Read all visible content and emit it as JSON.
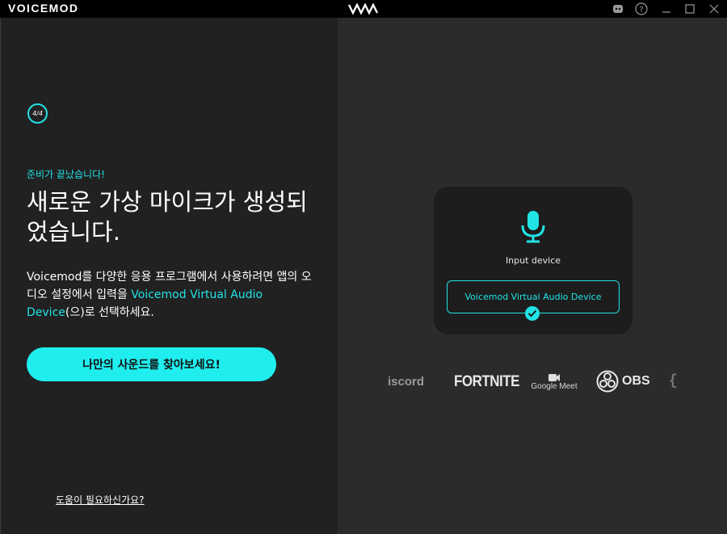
{
  "titlebar": {
    "brand": "VOICEMOD",
    "logo_icon": "vm-logo-icon",
    "buttons": [
      "discord-icon",
      "help-icon",
      "minimize-icon",
      "maximize-icon",
      "close-icon"
    ]
  },
  "onboarding": {
    "step": "4/4",
    "ready_text": "준비가 끝났습니다!",
    "headline": "새로운 가상 마이크가 생성되었습니다.",
    "description_part1": "Voicemod를 다양한 응용 프로그램에서 사용하려면 앱의 오디오 설정에서 입력을 ",
    "description_highlight": "Voicemod Virtual Audio Device",
    "description_part2": "(으)로 선택하세요.",
    "cta_label": "나만의 사운드를 찾아보세요!",
    "help_link": "도움이 필요하신가요?"
  },
  "device_card": {
    "label": "Input device",
    "device_name": "Voicemod Virtual Audio Device",
    "mic_icon": "microphone-icon",
    "check_icon": "check-icon"
  },
  "app_logos": [
    "iscord",
    "FORTNITE",
    "Google Meet",
    "OBS",
    "{"
  ],
  "colors": {
    "accent": "#21e3e6",
    "button_bg": "#20eeee",
    "left_bg": "#212121",
    "right_bg": "#2b2b2b",
    "card_bg": "#1d1d1d"
  }
}
